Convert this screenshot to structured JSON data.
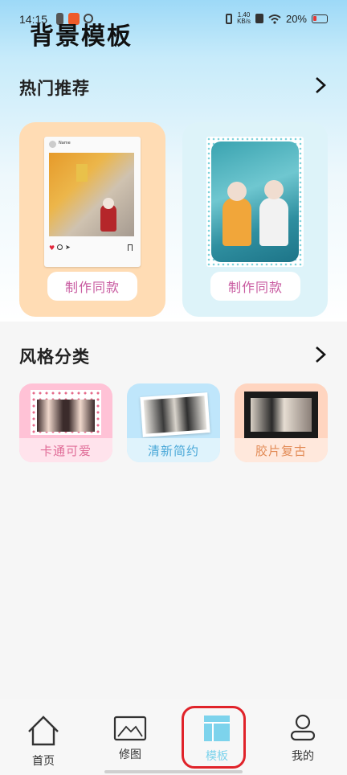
{
  "status_bar": {
    "time": "14:15",
    "net_speed_value": "1.40",
    "net_speed_unit": "KB/s",
    "battery": "20%"
  },
  "header": {
    "title": "背景模板"
  },
  "hot": {
    "title": "热门推荐",
    "cards": [
      {
        "button": "制作同款",
        "photo_caption": "Name"
      },
      {
        "button": "制作同款"
      }
    ]
  },
  "styles": {
    "title": "风格分类",
    "items": [
      {
        "label": "卡通可爱"
      },
      {
        "label": "清新简约"
      },
      {
        "label": "胶片复古"
      }
    ]
  },
  "nav": {
    "items": [
      {
        "label": "首页",
        "icon": "house-icon"
      },
      {
        "label": "修图",
        "icon": "image-icon"
      },
      {
        "label": "模板",
        "icon": "template-grid-icon",
        "active": true
      },
      {
        "label": "我的",
        "icon": "person-icon"
      }
    ]
  },
  "colors": {
    "accent": "#7dd3ec",
    "highlight": "#e0232a",
    "button_text": "#c85aa0"
  }
}
